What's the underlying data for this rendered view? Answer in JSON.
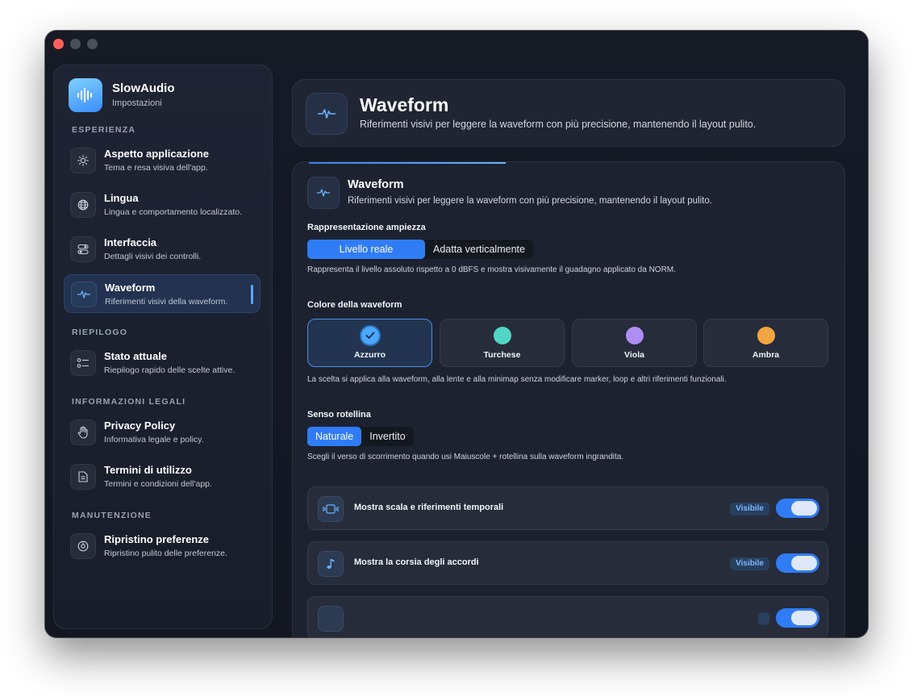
{
  "app": {
    "name": "SlowAudio",
    "subtitle": "Impostazioni"
  },
  "sidebar": {
    "sections": [
      {
        "title": "ESPERIENZA"
      },
      {
        "title": "RIEPILOGO"
      },
      {
        "title": "INFORMAZIONI LEGALI"
      },
      {
        "title": "MANUTENZIONE"
      }
    ],
    "items": [
      {
        "label": "Aspetto applicazione",
        "desc": "Tema e resa visiva dell'app.",
        "icon": "sun-icon"
      },
      {
        "label": "Lingua",
        "desc": "Lingua e comportamento localizzato.",
        "icon": "globe-icon"
      },
      {
        "label": "Interfaccia",
        "desc": "Dettagli visivi dei controlli.",
        "icon": "toggles-icon"
      },
      {
        "label": "Waveform",
        "desc": "Riferimenti visivi della waveform.",
        "icon": "waveform-icon",
        "active": true
      },
      {
        "label": "Stato attuale",
        "desc": "Riepilogo rapido delle scelte attive.",
        "icon": "checklist-icon"
      },
      {
        "label": "Privacy Policy",
        "desc": "Informativa legale e policy.",
        "icon": "hand-icon"
      },
      {
        "label": "Termini di utilizzo",
        "desc": "Termini e condizioni dell'app.",
        "icon": "document-icon"
      },
      {
        "label": "Ripristino preferenze",
        "desc": "Ripristino pulito delle preferenze.",
        "icon": "reset-icon"
      }
    ]
  },
  "header": {
    "title": "Waveform",
    "desc": "Riferimenti visivi per leggere la waveform con più precisione, mantenendo il layout pulito."
  },
  "panel": {
    "title": "Waveform",
    "desc": "Riferimenti visivi per leggere la waveform con più precisione, mantenendo il layout pulito.",
    "amplitude": {
      "label": "Rappresentazione ampiezza",
      "options": [
        "Livello reale",
        "Adatta verticalmente"
      ],
      "selected": "Livello reale",
      "help": "Rappresenta il livello assoluto rispetto a 0 dBFS e mostra visivamente il guadagno applicato da NORM."
    },
    "color": {
      "label": "Colore della waveform",
      "options": [
        {
          "name": "Azzurro",
          "hex": "#4aa8ff",
          "selected": true
        },
        {
          "name": "Turchese",
          "hex": "#4fd6c4",
          "selected": false
        },
        {
          "name": "Viola",
          "hex": "#b08cf5",
          "selected": false
        },
        {
          "name": "Ambra",
          "hex": "#f2a541",
          "selected": false
        }
      ],
      "help": "La scelta si applica alla waveform, alla lente e alla minimap senza modificare marker, loop e altri riferimenti funzionali."
    },
    "scroll": {
      "label": "Senso rotellina",
      "options": [
        "Naturale",
        "Invertito"
      ],
      "selected": "Naturale",
      "help": "Scegli il verso di scorrimento quando usi Maiuscole + rotellina sulla waveform ingrandita."
    },
    "toggles": [
      {
        "label": "Mostra scala e riferimenti temporali",
        "badge": "Visibile",
        "on": true,
        "icon": "timeline-icon"
      },
      {
        "label": "Mostra la corsia degli accordi",
        "badge": "Visibile",
        "on": true,
        "icon": "music-note-icon"
      },
      {
        "label": "",
        "badge": "",
        "on": true,
        "icon": "abc-icon"
      }
    ]
  },
  "colors": {
    "accent": "#2f7cf6",
    "selected_border": "#4a8fe8",
    "badge_text": "#7fb6ff"
  }
}
